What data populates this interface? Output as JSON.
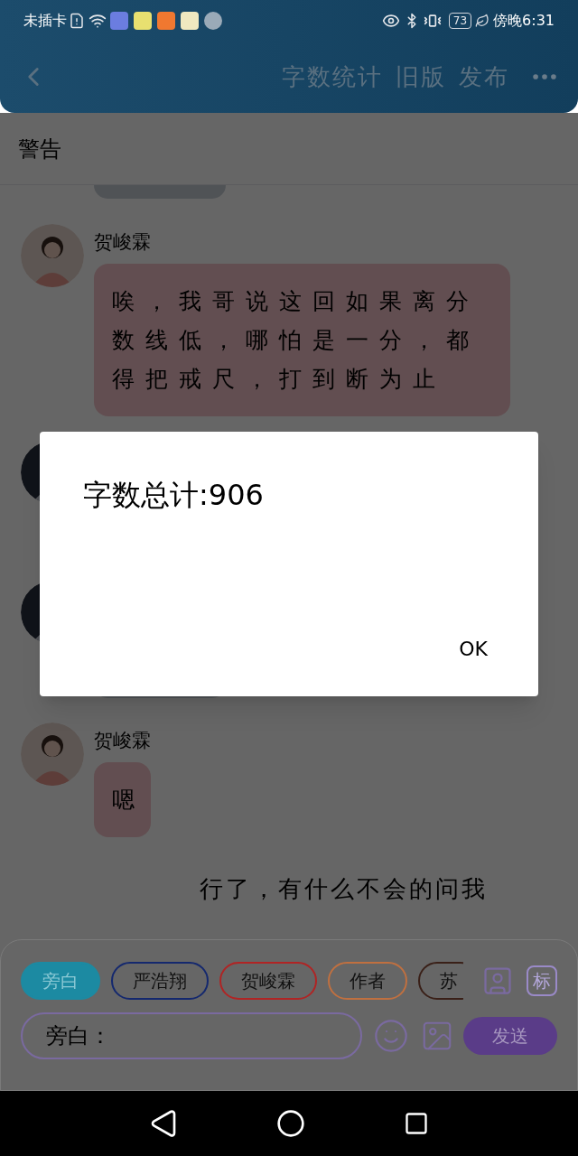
{
  "status_bar": {
    "carrier": "未插卡",
    "battery": "73",
    "time": "傍晚6:31"
  },
  "header": {
    "actions": [
      "字数统计",
      "旧版",
      "发布"
    ]
  },
  "section_title": "警告",
  "chat": [
    {
      "kind": "stub"
    },
    {
      "kind": "message",
      "sender": "贺峻霖",
      "text": "唉，我哥说这回如果离分数线低，哪怕是一分，都得把戒尺，打到断为止"
    },
    {
      "kind": "avatar"
    },
    {
      "kind": "avatar"
    },
    {
      "kind": "stub"
    },
    {
      "kind": "message",
      "sender": "贺峻霖",
      "text": "嗯"
    },
    {
      "kind": "narration",
      "text": "行了，有什么不会的问我"
    }
  ],
  "roles": [
    {
      "label": "旁白",
      "selected": true,
      "color": "#1c8aa2"
    },
    {
      "label": "严浩翔",
      "selected": false,
      "color": "#14286e"
    },
    {
      "label": "贺峻霖",
      "selected": false,
      "color": "#b02424"
    },
    {
      "label": "作者",
      "selected": false,
      "color": "#c07040"
    },
    {
      "label": "苏",
      "selected": false,
      "color": "#3a2018"
    }
  ],
  "tag_button": "标",
  "input": {
    "value": "旁白："
  },
  "send_button": "发送",
  "dialog": {
    "message": "字数总计:906",
    "button": "OK"
  }
}
